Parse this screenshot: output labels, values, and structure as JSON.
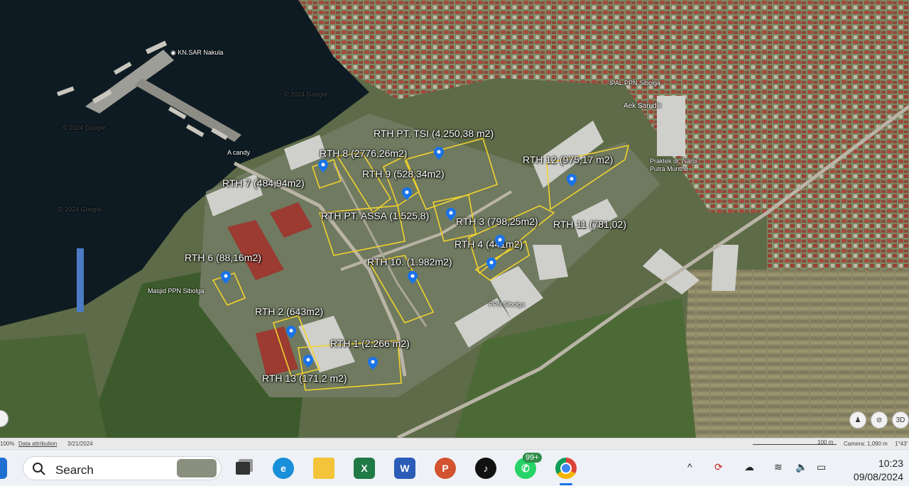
{
  "map": {
    "labels": [
      "RTH PT. TSI (4.250,38 m2)",
      "RTH 8 (2776,26m2)",
      "RTH 9 (528,34m2)",
      "RTH 7 (484,94m2)",
      "RTH 12 (975,17 m2)",
      "RTH PT. ASSA (1.525,8)",
      "RTH 3 (798,25m2)",
      "RTH 11 (781,02)",
      "RTH 4 (441m2)",
      "RTH 6 (88,16m2)",
      "RTH 10. (1.982m2)",
      "RTH 2 (643m2)",
      "RTH 1 (2.266 m2)",
      "RTH 13 (171,2 m2)"
    ],
    "places": [
      "KN.SAR Nakula",
      "IPAL PPN Sibolga",
      "Aek Sarudik",
      "A candy",
      "Praktek dr. Naroi Putra Munthe",
      "Masjid PPN Sibolga",
      "PPN Sibolga"
    ],
    "watermarks": [
      "© 2024 Google",
      "© 2024 Google",
      "© 2024 Google"
    ],
    "controls": {
      "person": "pegman-icon",
      "compass": "compass-icon",
      "view_3d": "3D"
    },
    "colors": {
      "outline": "#f2d22e",
      "pin": "#1a73e8",
      "water": "#0e1b22"
    }
  },
  "statusbar": {
    "zoom": "100%",
    "attribution": "Data attribution",
    "date": "3/21/2024",
    "scale": "100 m",
    "camera": "Camera: 1,090 m",
    "coords": "1°43'"
  },
  "taskbar": {
    "search_placeholder": "Search",
    "whatsapp_badge": "99+",
    "excel": "X",
    "word": "W",
    "powerpoint": "P",
    "time": "10:23",
    "date": "09/08/2024",
    "tray_chevron": "^"
  }
}
